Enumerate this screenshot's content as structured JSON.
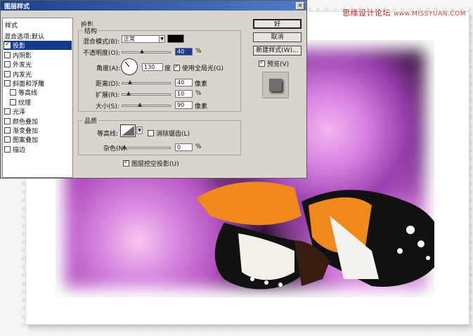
{
  "watermark": {
    "brand": "思缘设计论坛",
    "url": "www.MISSYUAN.COM"
  },
  "dialog": {
    "title": "图层样式",
    "close_glyph": "×",
    "left_panel": {
      "header": "样式",
      "items": [
        {
          "label": "混合选项:默认",
          "checkbox": false,
          "checked": false,
          "selected": false,
          "indent": false
        },
        {
          "label": "投影",
          "checkbox": true,
          "checked": true,
          "selected": true,
          "indent": false
        },
        {
          "label": "内阴影",
          "checkbox": true,
          "checked": false,
          "selected": false,
          "indent": false
        },
        {
          "label": "外发光",
          "checkbox": true,
          "checked": false,
          "selected": false,
          "indent": false
        },
        {
          "label": "内发光",
          "checkbox": true,
          "checked": false,
          "selected": false,
          "indent": false
        },
        {
          "label": "斜面和浮雕",
          "checkbox": true,
          "checked": false,
          "selected": false,
          "indent": false
        },
        {
          "label": "等高线",
          "checkbox": true,
          "checked": false,
          "selected": false,
          "indent": true
        },
        {
          "label": "纹理",
          "checkbox": true,
          "checked": false,
          "selected": false,
          "indent": true
        },
        {
          "label": "光泽",
          "checkbox": true,
          "checked": false,
          "selected": false,
          "indent": false
        },
        {
          "label": "颜色叠加",
          "checkbox": true,
          "checked": false,
          "selected": false,
          "indent": false
        },
        {
          "label": "渐变叠加",
          "checkbox": true,
          "checked": false,
          "selected": false,
          "indent": false
        },
        {
          "label": "图案叠加",
          "checkbox": true,
          "checked": false,
          "selected": false,
          "indent": false
        },
        {
          "label": "描边",
          "checkbox": true,
          "checked": false,
          "selected": false,
          "indent": false
        }
      ]
    },
    "section": "投影",
    "structure": {
      "title": "结构",
      "blend_mode_label": "混合模式(B):",
      "blend_mode_value": "正常",
      "shadow_color": "#000000",
      "opacity_label": "不透明度(O):",
      "opacity_value": "40",
      "opacity_unit": "%",
      "opacity_fraction": 0.4,
      "angle_label": "角度(A):",
      "angle_value": "130",
      "angle_unit": "度",
      "use_global_light_label": "使用全局光(G)",
      "use_global_light": true,
      "distance_label": "距离(D):",
      "distance_value": "40",
      "distance_unit": "像素",
      "distance_fraction": 0.13,
      "spread_label": "扩展(R):",
      "spread_value": "10",
      "spread_unit": "%",
      "spread_fraction": 0.1,
      "size_label": "大小(S):",
      "size_value": "90",
      "size_unit": "像素",
      "size_fraction": 0.36
    },
    "quality": {
      "title": "品质",
      "contour_label": "等高线:",
      "antialias_label": "消除锯齿(L)",
      "antialias": false,
      "noise_label": "杂色(N):",
      "noise_value": "0",
      "noise_unit": "%",
      "noise_fraction": 0.0,
      "knockout_label": "图层挖空投影(U)",
      "knockout": true
    },
    "buttons": {
      "ok": "好",
      "cancel": "取消",
      "new_style": "新建样式(W)...",
      "preview_label": "预览(V)",
      "preview_checked": true
    }
  }
}
